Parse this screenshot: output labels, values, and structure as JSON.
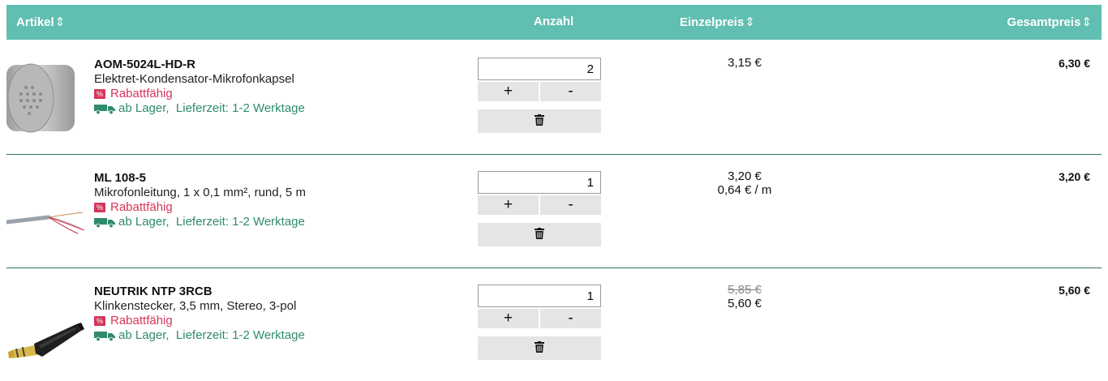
{
  "header": {
    "artikel": "Artikel",
    "anzahl": "Anzahl",
    "einzelpreis": "Einzelpreis",
    "gesamtpreis": "Gesamtpreis",
    "sort_glyph": "⇕"
  },
  "items": [
    {
      "name": "AOM-5024L-HD-R",
      "description": "Elektret-Kondensator-Mikrofonkapsel",
      "badge": "%",
      "rabatt": "Rabattfähig",
      "lager": "ab Lager,",
      "lieferzeit": "Lieferzeit: 1-2 Werktage",
      "quantity": "2",
      "plus": "+",
      "minus": "-",
      "unit_price": "3,15 €",
      "total": "6,30 €",
      "thumbnail": "microphone-capsule"
    },
    {
      "name": "ML 108-5",
      "description": "Mikrofonleitung, 1 x 0,1 mm², rund, 5 m",
      "badge": "%",
      "rabatt": "Rabattfähig",
      "lager": "ab Lager,",
      "lieferzeit": "Lieferzeit: 1-2 Werktage",
      "quantity": "1",
      "plus": "+",
      "minus": "-",
      "unit_price": "3,20 €",
      "unit_price_per_meter": "0,64 € / m",
      "total": "3,20 €",
      "thumbnail": "microphone-cable"
    },
    {
      "name": "NEUTRIK NTP 3RCB",
      "description": "Klinkenstecker, 3,5 mm, Stereo, 3-pol",
      "badge": "%",
      "rabatt": "Rabattfähig",
      "lager": "ab Lager,",
      "lieferzeit": "Lieferzeit: 1-2 Werktage",
      "quantity": "1",
      "plus": "+",
      "minus": "-",
      "old_price": "5,85 €",
      "unit_price": "5,60 €",
      "total": "5,60 €",
      "thumbnail": "jack-plug"
    }
  ],
  "colors": {
    "header_bg": "#60bfb0",
    "rabatt": "#d6355b",
    "lager": "#2f8a6e",
    "divider": "#2e6f6a"
  },
  "icons": {
    "sort": "sort-arrows-icon",
    "delete": "trash-icon",
    "delivery": "truck-icon",
    "discount": "percent-badge-icon"
  }
}
